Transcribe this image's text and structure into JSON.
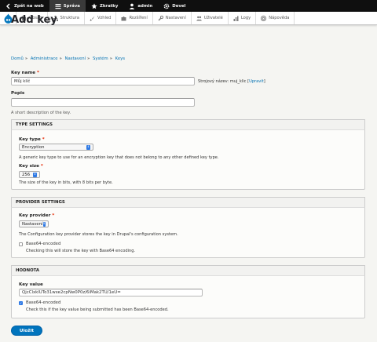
{
  "toolbar": {
    "items": [
      {
        "label": "Zpět na web",
        "icon": "back-arrow-icon"
      },
      {
        "label": "Správa",
        "icon": "menu-icon"
      },
      {
        "label": "Zkratky",
        "icon": "star-icon"
      },
      {
        "label": "admin",
        "icon": "user-icon"
      },
      {
        "label": "Devel",
        "icon": "gear-icon"
      }
    ]
  },
  "admin_menu": {
    "items": [
      {
        "label": "Obsah",
        "icon": "file-icon"
      },
      {
        "label": "Struktura",
        "icon": "structure-icon"
      },
      {
        "label": "Vzhled",
        "icon": "brush-icon"
      },
      {
        "label": "Rozšíření",
        "icon": "puzzle-icon"
      },
      {
        "label": "Nastavení",
        "icon": "wrench-icon"
      },
      {
        "label": "Uživatelé",
        "icon": "people-icon"
      },
      {
        "label": "Logy",
        "icon": "chart-icon"
      },
      {
        "label": "Nápověda",
        "icon": "help-icon"
      }
    ]
  },
  "page": {
    "title": "Add key",
    "breadcrumb": [
      "Domů",
      "Administrace",
      "Nastavení",
      "Systém",
      "Keys"
    ]
  },
  "form": {
    "key_name_label": "Key name",
    "key_name_value": "Můj klíč",
    "machine_name_prefix": "Strojový název: muj_klic",
    "machine_name_link": "Upravit",
    "description_label": "Popis",
    "description_value": "",
    "description_help": "A short description of the key.",
    "type_settings": {
      "legend": "TYPE SETTINGS",
      "key_type_label": "Key type",
      "key_type_value": "Encryption",
      "key_type_help": "A generic key type to use for an encryption key that does not belong to any other defined key type.",
      "key_size_label": "Key size",
      "key_size_value": "256",
      "key_size_help": "The size of the key in bits, with 8 bits per byte."
    },
    "provider_settings": {
      "legend": "PROVIDER SETTINGS",
      "provider_label": "Key provider",
      "provider_value": "Nastavení",
      "provider_help": "The Configuration key provider stores the key in Drupal's configuration system.",
      "base64_label": "Base64-encoded",
      "base64_checked": false,
      "base64_help": "Checking this will store the key with Base64 encoding."
    },
    "value_settings": {
      "legend": "HODNOTA",
      "key_value_label": "Key value",
      "key_value": "QjcClxklUTo31wxe2cpNw0P0z/6iMak2TU/1eU=",
      "base64_label": "Base64-encoded",
      "base64_checked": true,
      "base64_help": "Check this if the key value being submitted has been Base64-encoded."
    },
    "save_label": "Uložit"
  },
  "colors": {
    "accent": "#0074bd",
    "link": "#0071b3",
    "required": "#e62600",
    "toolbar_bg": "#0f0f0f"
  }
}
